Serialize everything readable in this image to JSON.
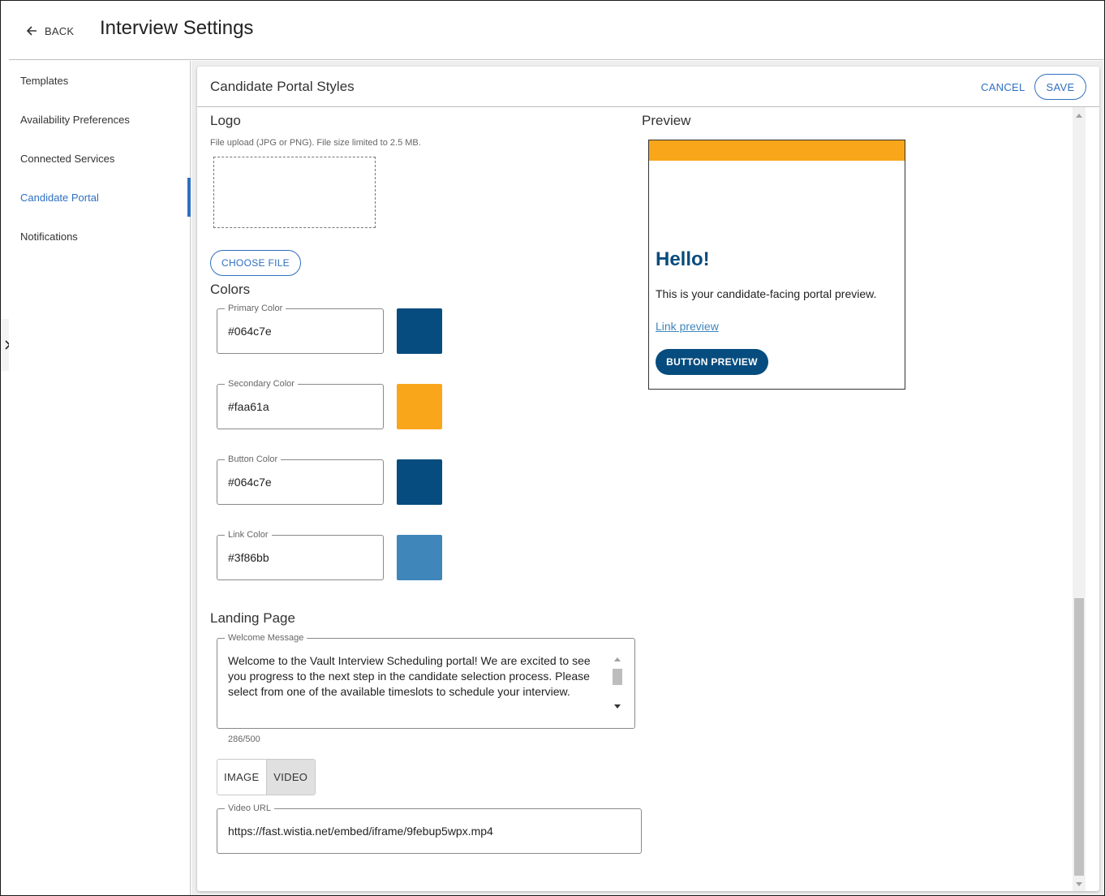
{
  "header": {
    "back_label": "BACK",
    "title": "Interview Settings"
  },
  "sidebar": {
    "items": [
      {
        "label": "Templates"
      },
      {
        "label": "Availability Preferences"
      },
      {
        "label": "Connected Services"
      },
      {
        "label": "Candidate Portal",
        "active": true
      },
      {
        "label": "Notifications"
      }
    ]
  },
  "card": {
    "title": "Candidate Portal Styles",
    "cancel_label": "CANCEL",
    "save_label": "SAVE"
  },
  "logo": {
    "heading": "Logo",
    "hint": "File upload (JPG or PNG). File size limited to 2.5 MB.",
    "choose_file_label": "CHOOSE FILE"
  },
  "colors": {
    "heading": "Colors",
    "fields": [
      {
        "label": "Primary Color",
        "value": "#064c7e"
      },
      {
        "label": "Secondary Color",
        "value": "#faa61a"
      },
      {
        "label": "Button Color",
        "value": "#064c7e"
      },
      {
        "label": "Link Color",
        "value": "#3f86bb"
      }
    ]
  },
  "preview": {
    "heading": "Preview",
    "hello": "Hello!",
    "text": "This is your candidate-facing portal preview.",
    "link": "Link preview",
    "button": "BUTTON PREVIEW"
  },
  "landing": {
    "heading": "Landing Page",
    "welcome_label": "Welcome Message",
    "welcome_text": "Welcome to the Vault Interview Scheduling portal!  We are excited to see you progress to the next step in the candidate selection process. Please select from one of the available timeslots to schedule your interview.",
    "counter": "286/500",
    "media_options": [
      "IMAGE",
      "VIDEO"
    ],
    "media_selected": "VIDEO",
    "video_url_label": "Video URL",
    "video_url": "https://fast.wistia.net/embed/iframe/9febup5wpx.mp4"
  },
  "icons": {
    "back": "arrow-left-icon",
    "edge_toggle": "chevron-right-icon"
  }
}
